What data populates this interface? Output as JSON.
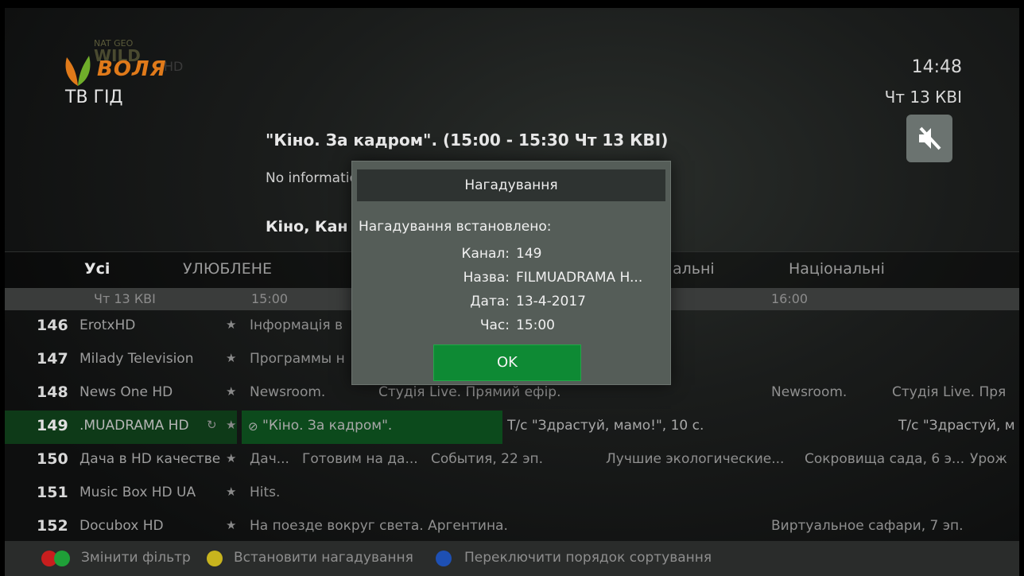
{
  "header": {
    "logo_brand": "ВОЛЯ",
    "logo_channel_small": "NAT GEO",
    "logo_channel": "WILD",
    "logo_suffix": "HD",
    "title": "ТВ ГІД",
    "time": "14:48",
    "date": "Чт 13 КВІ",
    "mute_icon": "speaker-muted-icon"
  },
  "program": {
    "title": "\"Кіно. За кадром\".   (15:00 - 15:30 Чт 13 КВІ)",
    "info": "No information",
    "genre": "Кіно, Кан"
  },
  "tabs": [
    {
      "label": "Усі",
      "active": true
    },
    {
      "label": "УЛЮБЛЕНЕ",
      "active": false
    },
    {
      "label": "альні",
      "active": false
    },
    {
      "label": "Національні",
      "active": false
    }
  ],
  "timeline": {
    "date": "Чт 13 КВІ",
    "t1": "15:00",
    "t2": "16:00"
  },
  "channels": [
    {
      "num": "146",
      "name": "ErotxHD",
      "events": [
        "Інформація в"
      ]
    },
    {
      "num": "147",
      "name": "Milady Television",
      "events": [
        "Программы н"
      ]
    },
    {
      "num": "148",
      "name": "News One HD",
      "events": [
        "Newsroom.",
        "Студія Live. Прямий ефір.",
        "Newsroom.",
        "Студія Live. Пря"
      ]
    },
    {
      "num": "149",
      "name": ".MUADRAMA HD",
      "events": [
        "\"Кіно. За кадром\".",
        "Т/с \"Здрастуй, мамо!\", 10 с.",
        "Т/с \"Здрастуй, м"
      ]
    },
    {
      "num": "150",
      "name": "Дача в HD качестве",
      "events": [
        "Дач...",
        "Готовим на да...",
        "События, 22 эп.",
        "Лучшие экологические...",
        "Сокровища сада, 6 э...",
        "Урож"
      ]
    },
    {
      "num": "151",
      "name": "Music Box HD UA",
      "events": [
        "Hits."
      ]
    },
    {
      "num": "152",
      "name": "Docubox HD",
      "events": [
        "На поезде вокруг света. Аргентина.",
        "Виртуальное сафари, 7 эп."
      ]
    }
  ],
  "footer": {
    "filter_label": "Змінити фільтр",
    "reminder_label": "Встановити нагадування",
    "sort_label": "Переключити порядок сортування",
    "colors": {
      "red": "#c81e1e",
      "green": "#1fa038",
      "yellow": "#c8b41e",
      "blue": "#1e50b4"
    }
  },
  "dialog": {
    "title": "Нагадування",
    "message": "Нагадування встановлено:",
    "fields": [
      {
        "key": "Канал:",
        "value": "149"
      },
      {
        "key": "Назва:",
        "value": "FILMUADRAMA H..."
      },
      {
        "key": "Дата:",
        "value": "13-4-2017"
      },
      {
        "key": "Час:",
        "value": "15:00"
      }
    ],
    "ok_label": "OK"
  }
}
